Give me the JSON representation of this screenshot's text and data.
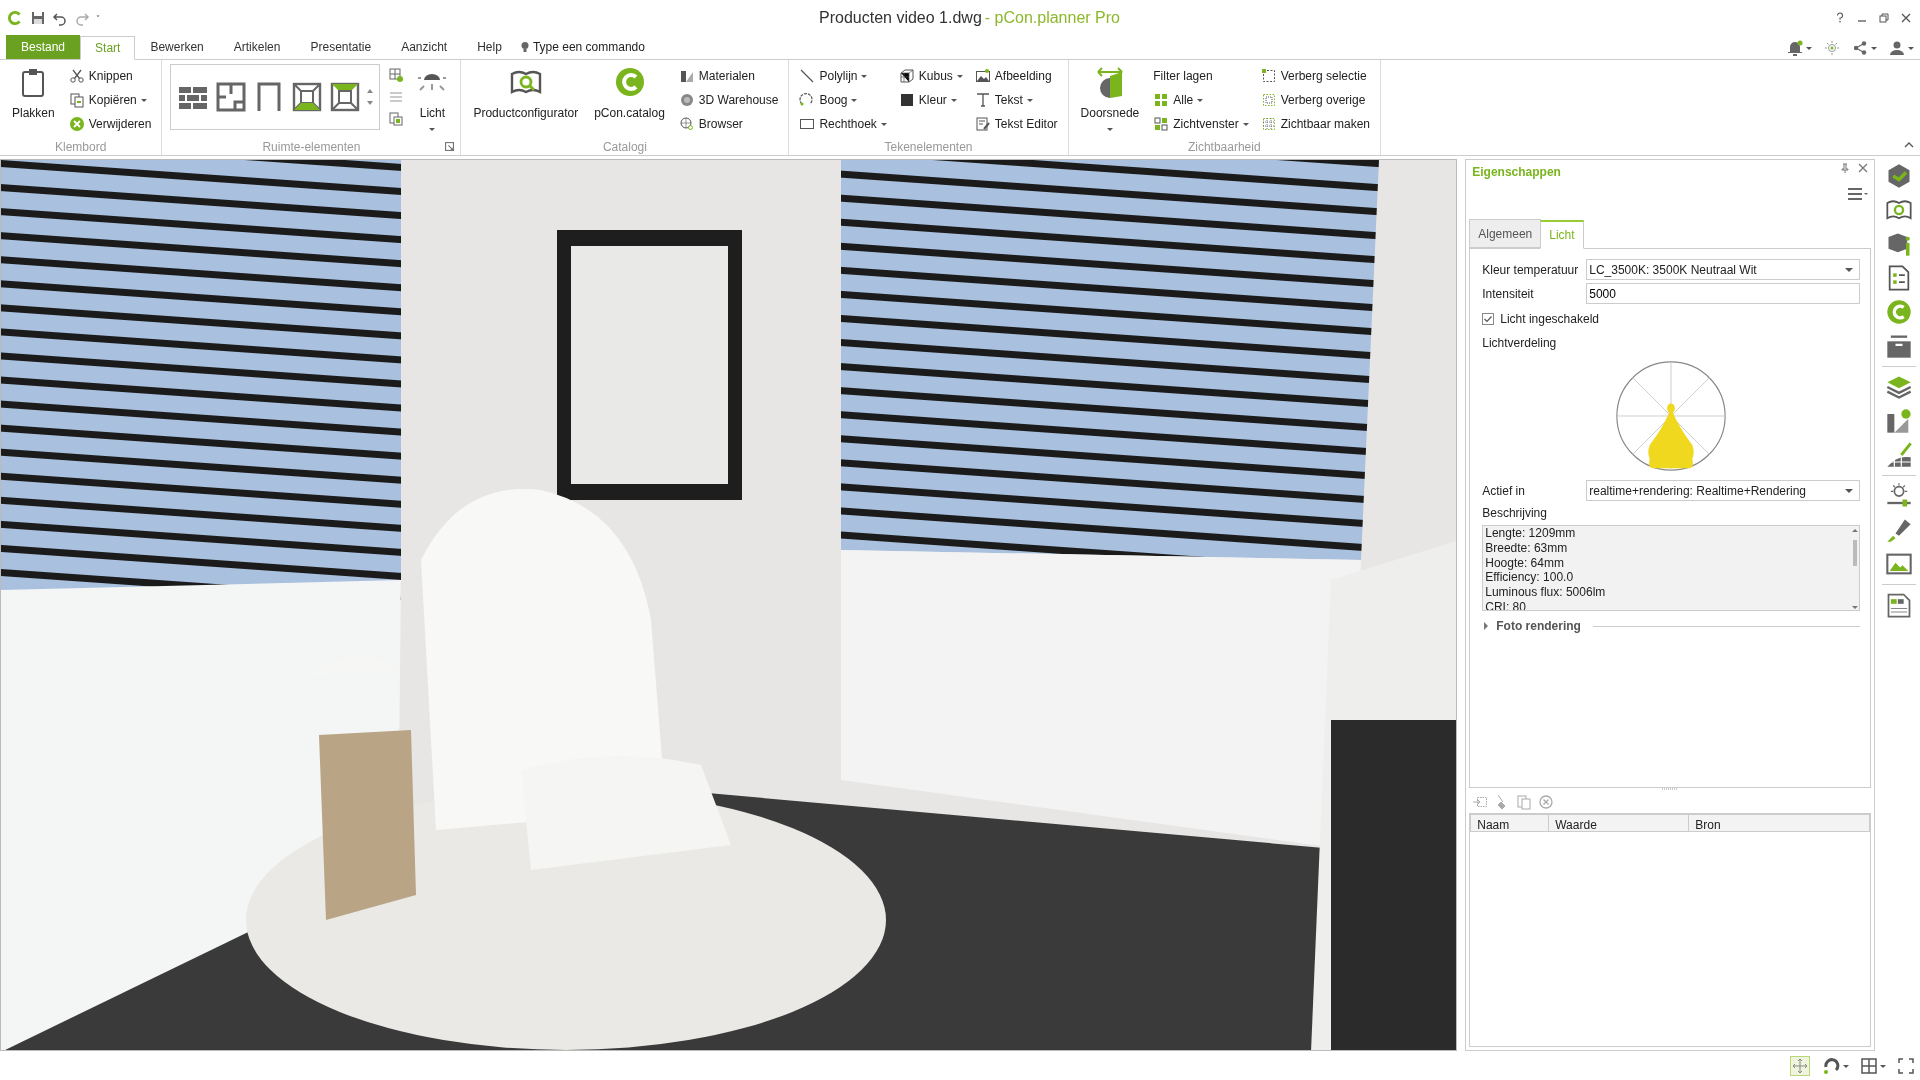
{
  "window": {
    "document": "Producten video 1.dwg",
    "app": "- pCon.planner Pro"
  },
  "menu": [
    {
      "label": "Bestand",
      "kind": "file",
      "selected": false
    },
    {
      "label": "Start",
      "kind": "tab",
      "selected": true
    },
    {
      "label": "Bewerken",
      "kind": "tab",
      "selected": false
    },
    {
      "label": "Artikelen",
      "kind": "tab",
      "selected": false
    },
    {
      "label": "Presentatie",
      "kind": "tab",
      "selected": false
    },
    {
      "label": "Aanzicht",
      "kind": "tab",
      "selected": false
    },
    {
      "label": "Help",
      "kind": "tab",
      "selected": false
    }
  ],
  "command_search": {
    "placeholder": "Type een commando"
  },
  "ribbon": [
    {
      "name": "Klembord",
      "launcher": false,
      "columns": [
        {
          "kind": "large",
          "items": [
            {
              "label": "Plakken",
              "dropdown": false
            }
          ]
        },
        {
          "kind": "stack",
          "items": [
            {
              "label": "Knippen",
              "dropdown": false
            },
            {
              "label": "Kopiëren",
              "dropdown": true
            },
            {
              "label": "Verwijderen",
              "dropdown": false
            }
          ]
        }
      ]
    },
    {
      "name": "Ruimte-elementen",
      "launcher": true,
      "columns": [
        {
          "kind": "gallery"
        },
        {
          "kind": "icons"
        },
        {
          "kind": "large",
          "items": [
            {
              "label": "Licht",
              "dropdown": true
            }
          ]
        }
      ]
    },
    {
      "name": "Catalogi",
      "launcher": false,
      "columns": [
        {
          "kind": "large",
          "items": [
            {
              "label": "Productconfigurator",
              "dropdown": false
            }
          ]
        },
        {
          "kind": "large",
          "items": [
            {
              "label": "pCon.catalog",
              "dropdown": false
            }
          ]
        },
        {
          "kind": "stack",
          "items": [
            {
              "label": "Materialen",
              "dropdown": false
            },
            {
              "label": "3D Warehouse",
              "dropdown": false
            },
            {
              "label": "Browser",
              "dropdown": false
            }
          ]
        }
      ]
    },
    {
      "name": "Tekenelementen",
      "launcher": false,
      "columns": [
        {
          "kind": "stack",
          "items": [
            {
              "label": "Polylijn",
              "dropdown": true
            },
            {
              "label": "Boog",
              "dropdown": true
            },
            {
              "label": "Rechthoek",
              "dropdown": true
            }
          ]
        },
        {
          "kind": "stack",
          "items": [
            {
              "label": "Kubus",
              "dropdown": true
            },
            {
              "label": "Kleur",
              "dropdown": true
            }
          ]
        },
        {
          "kind": "stack",
          "items": [
            {
              "label": "Afbeelding",
              "dropdown": false
            },
            {
              "label": "Tekst",
              "dropdown": true
            },
            {
              "label": "Tekst Editor",
              "dropdown": false
            }
          ]
        }
      ]
    },
    {
      "name": "Zichtbaarheid",
      "launcher": false,
      "columns": [
        {
          "kind": "large",
          "items": [
            {
              "label": "Doorsnede",
              "dropdown": true
            }
          ]
        },
        {
          "kind": "stack",
          "items": [
            {
              "label": "Filter lagen",
              "dropdown": false,
              "plain": true
            },
            {
              "label": "Alle",
              "dropdown": true,
              "plain": false
            },
            {
              "label": "Zichtvenster",
              "dropdown": true,
              "plain": false
            }
          ]
        },
        {
          "kind": "stack",
          "items": [
            {
              "label": "Verberg selectie",
              "dropdown": false
            },
            {
              "label": "Verberg overige",
              "dropdown": false
            },
            {
              "label": "Zichtbaar maken",
              "dropdown": false
            }
          ]
        }
      ]
    }
  ],
  "properties": {
    "title": "Eigenschappen",
    "tabs": [
      {
        "label": "Algemeen",
        "selected": false
      },
      {
        "label": "Licht",
        "selected": true
      }
    ],
    "fields": [
      {
        "kind": "select",
        "label": "Kleur temperatuur",
        "value": "LC_3500K: 3500K Neutraal Wit"
      },
      {
        "kind": "input",
        "label": "Intensiteit",
        "value": "5000"
      },
      {
        "kind": "checkbox",
        "label": "Licht ingeschakeld",
        "checked": true
      },
      {
        "kind": "diagram",
        "label": "Lichtverdeling"
      },
      {
        "kind": "select",
        "label": "Actief in",
        "value": "realtime+rendering: Realtime+Rendering"
      },
      {
        "kind": "textarea",
        "label": "Beschrijving",
        "lines": [
          "Lengte: 1209mm",
          "Breedte: 63mm",
          "Hoogte: 64mm",
          "Efficiency: 100.0",
          "Luminous flux: 5006lm",
          "CRI: 80"
        ]
      },
      {
        "kind": "section",
        "label": "Foto rendering",
        "expanded": false
      }
    ],
    "table": {
      "columns": [
        "Naam",
        "Waarde",
        "Bron"
      ]
    }
  }
}
